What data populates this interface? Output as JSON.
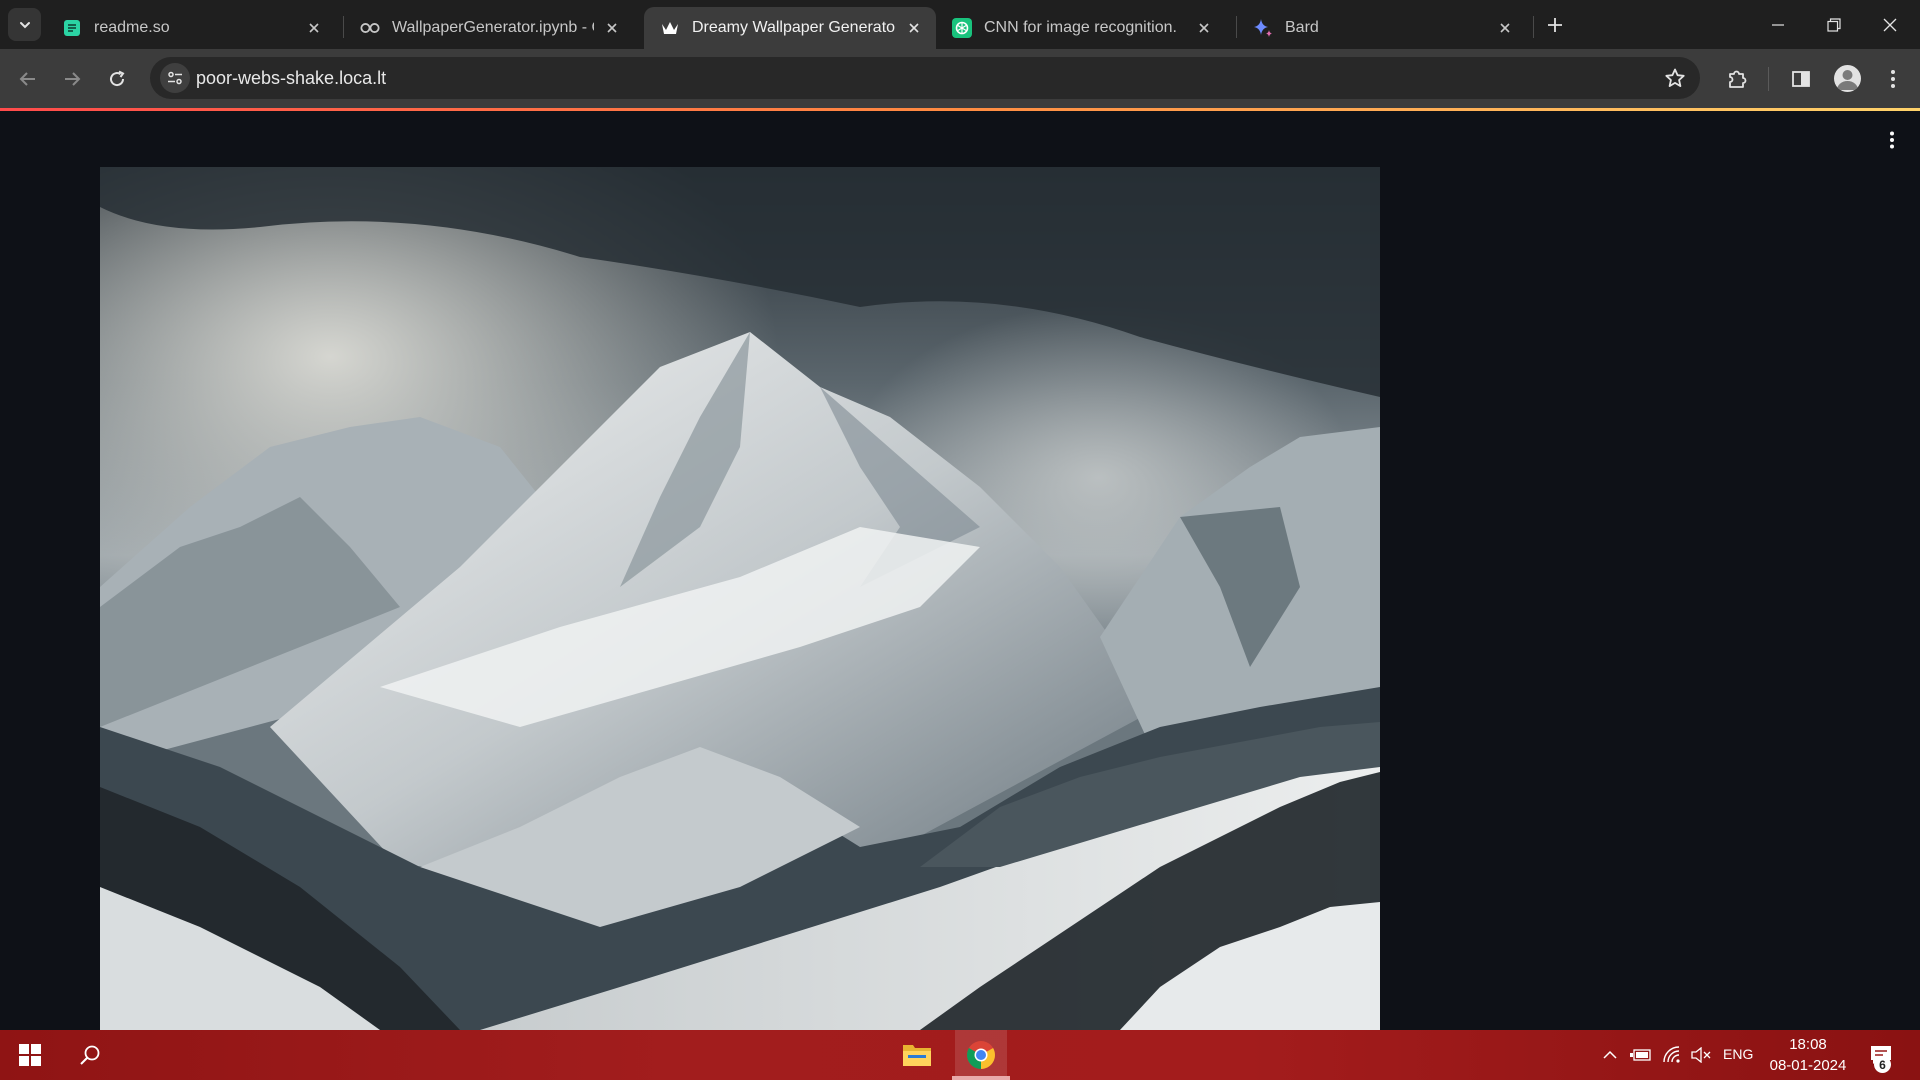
{
  "browser": {
    "tabs": [
      {
        "title": "readme.so",
        "icon": "readme-icon",
        "active": false
      },
      {
        "title": "WallpaperGenerator.ipynb - Col",
        "icon": "colab-icon",
        "active": false
      },
      {
        "title": "Dreamy Wallpaper Generator",
        "icon": "streamlit-crown-icon",
        "active": true
      },
      {
        "title": "CNN for image recognition.",
        "icon": "chatgpt-icon",
        "active": false
      },
      {
        "title": "Bard",
        "icon": "bard-sparkle-icon",
        "active": false
      }
    ],
    "address": {
      "url": "poor-webs-shake.loca.lt"
    },
    "load_progress_colors": [
      "#ff4b4b",
      "#ff8c42",
      "#ffd36b"
    ]
  },
  "page": {
    "image_alt": "Snow-covered mountain peaks under dark stormy clouds"
  },
  "taskbar": {
    "pinned": [
      "start-icon",
      "search-icon",
      "file-explorer-icon",
      "chrome-icon"
    ],
    "tray": {
      "language": "ENG",
      "time": "18:08",
      "date": "08-01-2024",
      "notification_count": "6"
    }
  }
}
